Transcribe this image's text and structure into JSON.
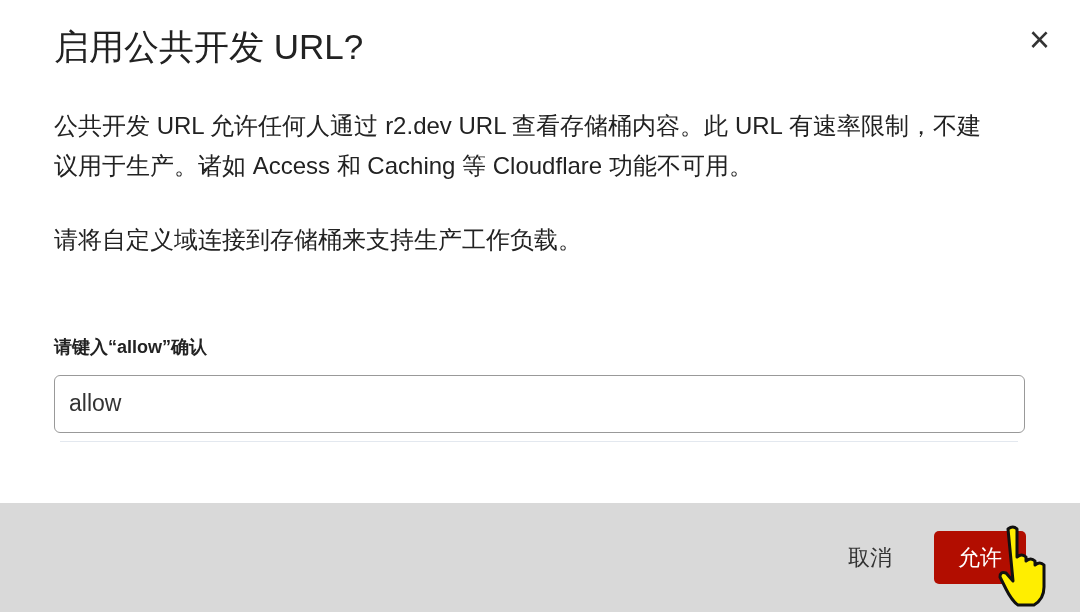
{
  "dialog": {
    "title": "启用公共开发 URL?",
    "close": "×",
    "paragraphs": [
      "公共开发 URL 允许任何人通过 r2.dev URL 查看存储桶内容。此 URL 有速率限制，不建议用于生产。诸如 Access 和 Caching 等 Cloudflare 功能不可用。",
      "请将自定义域连接到存储桶来支持生产工作负载。"
    ],
    "field": {
      "label": "请键入“allow”确认",
      "value": "allow"
    },
    "buttons": [
      {
        "label": "取消",
        "kind": "secondary"
      },
      {
        "label": "允许",
        "kind": "primary"
      }
    ]
  }
}
